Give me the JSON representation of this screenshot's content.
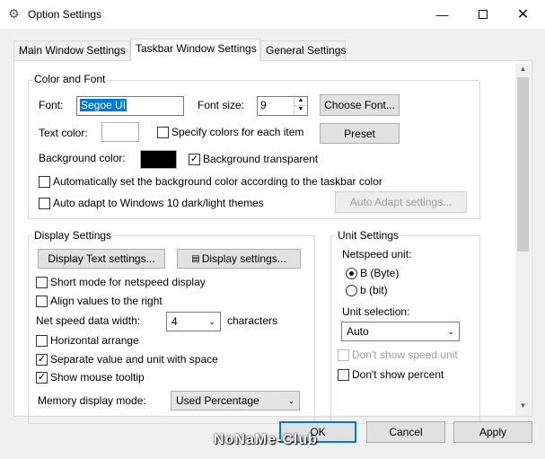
{
  "window": {
    "title": "Option Settings",
    "min_icon": "minimize-icon",
    "max_icon": "maximize-icon",
    "close_icon": "close-icon"
  },
  "tabs": [
    {
      "label": "Main Window Settings"
    },
    {
      "label": "Taskbar Window Settings"
    },
    {
      "label": "General Settings"
    }
  ],
  "color_font": {
    "title": "Color and Font",
    "font_label": "Font:",
    "font_value": "Segoe UI",
    "font_size_label": "Font size:",
    "font_size_value": "9",
    "choose_font_btn": "Choose Font...",
    "text_color_label": "Text color:",
    "specify_colors_label": "Specify colors for each item",
    "specify_colors_checked": false,
    "preset_btn": "Preset",
    "bg_color_label": "Background color:",
    "bg_color": "#000000",
    "bg_transparent_label": "Background transparent",
    "bg_transparent_checked": true,
    "auto_bg_label": "Automatically set the background color according to the taskbar color",
    "auto_bg_checked": false,
    "auto_adapt_label": "Auto adapt to Windows 10 dark/light themes",
    "auto_adapt_checked": false,
    "auto_adapt_btn": "Auto Adapt settings..."
  },
  "display": {
    "title": "Display Settings",
    "display_text_btn": "Display Text settings...",
    "display_settings_btn": "Display settings...",
    "short_mode_label": "Short mode for netspeed display",
    "align_right_label": "Align values to the right",
    "net_width_label": "Net speed data width:",
    "net_width_value": "4",
    "characters_label": "characters",
    "horizontal_label": "Horizontal arrange",
    "separate_label": "Separate value and unit with space",
    "separate_checked": true,
    "tooltip_label": "Show mouse tooltip",
    "tooltip_checked": true,
    "memory_mode_label": "Memory display mode:",
    "memory_mode_value": "Used Percentage"
  },
  "unit": {
    "title": "Unit Settings",
    "netspeed_unit_label": "Netspeed unit:",
    "byte_label": "B (Byte)",
    "bit_label": "b (bit)",
    "selected_unit": "byte",
    "unit_selection_label": "Unit selection:",
    "unit_selection_value": "Auto",
    "dont_show_speed_unit_label": "Don't show speed unit",
    "dont_show_percent_label": "Don't show percent"
  },
  "footer": {
    "ok": "OK",
    "cancel": "Cancel",
    "apply": "Apply"
  },
  "watermark": "NoNaMe-Club"
}
